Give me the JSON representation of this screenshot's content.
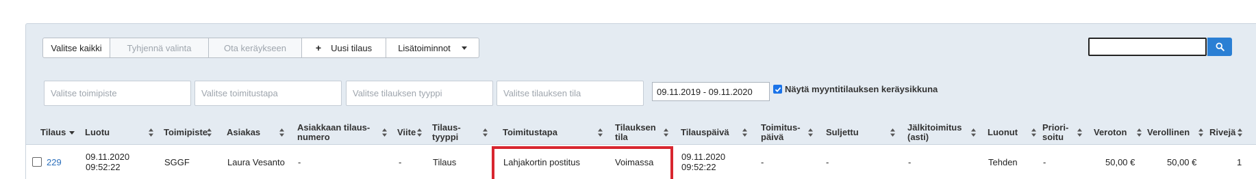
{
  "toolbar": {
    "select_all": "Valitse kaikki",
    "clear_selection": "Tyhjennä valinta",
    "to_picking": "Ota keräykseen",
    "new_order_icon": "+",
    "new_order": "Uusi tilaus",
    "more_actions": "Lisätoiminnot"
  },
  "search": {
    "value": "",
    "button_icon": "search-icon"
  },
  "filters": {
    "office_placeholder": "Valitse toimipiste",
    "delivery_placeholder": "Valitse toimitustapa",
    "order_type_placeholder": "Valitse tilauksen tyyppi",
    "order_status_placeholder": "Valitse tilauksen tila",
    "date_range": "09.11.2019 - 09.11.2020",
    "show_picking_window_label": "Näytä myyntitilauksen keräysikkuna",
    "show_picking_window_checked": true
  },
  "table": {
    "headers": {
      "order": "Tilaus",
      "created": "Luotu",
      "office": "Toimipiste",
      "customer": "Asiakas",
      "customer_order_no_1": "Asiakkaan tilaus-",
      "customer_order_no_2": "numero",
      "reference": "Viite",
      "order_type_1": "Tilaus-",
      "order_type_2": "tyyppi",
      "delivery_method": "Toimitustapa",
      "order_status_1": "Tilauksen",
      "order_status_2": "tila",
      "order_date": "Tilauspäivä",
      "delivery_date_1": "Toimitus-",
      "delivery_date_2": "päivä",
      "closed": "Suljettu",
      "backorder_1": "Jälkitoimitus",
      "backorder_2": "(asti)",
      "created_by": "Luonut",
      "priority_1": "Priori-",
      "priority_2": "soitu",
      "net": "Veroton",
      "gross": "Verollinen",
      "rows": "Rivejä"
    },
    "row": {
      "order": "229",
      "created_date": "09.11.2020",
      "created_time": "09:52:22",
      "office": "SGGF",
      "customer": "Laura Vesanto",
      "customer_order_no": "-",
      "reference": "-",
      "order_type": "Tilaus",
      "delivery_method": "Lahjakortin postitus",
      "order_status": "Voimassa",
      "order_date": "09.11.2020",
      "order_time": "09:52:22",
      "delivery_date": "-",
      "closed": "-",
      "backorder": "-",
      "created_by": "Tehden",
      "priority": "-",
      "net": "50,00 €",
      "gross": "50,00 €",
      "rows": "1"
    }
  },
  "colors": {
    "accent": "#2a7fd4",
    "highlight": "#d8262f",
    "panel": "#e4ebf2"
  }
}
